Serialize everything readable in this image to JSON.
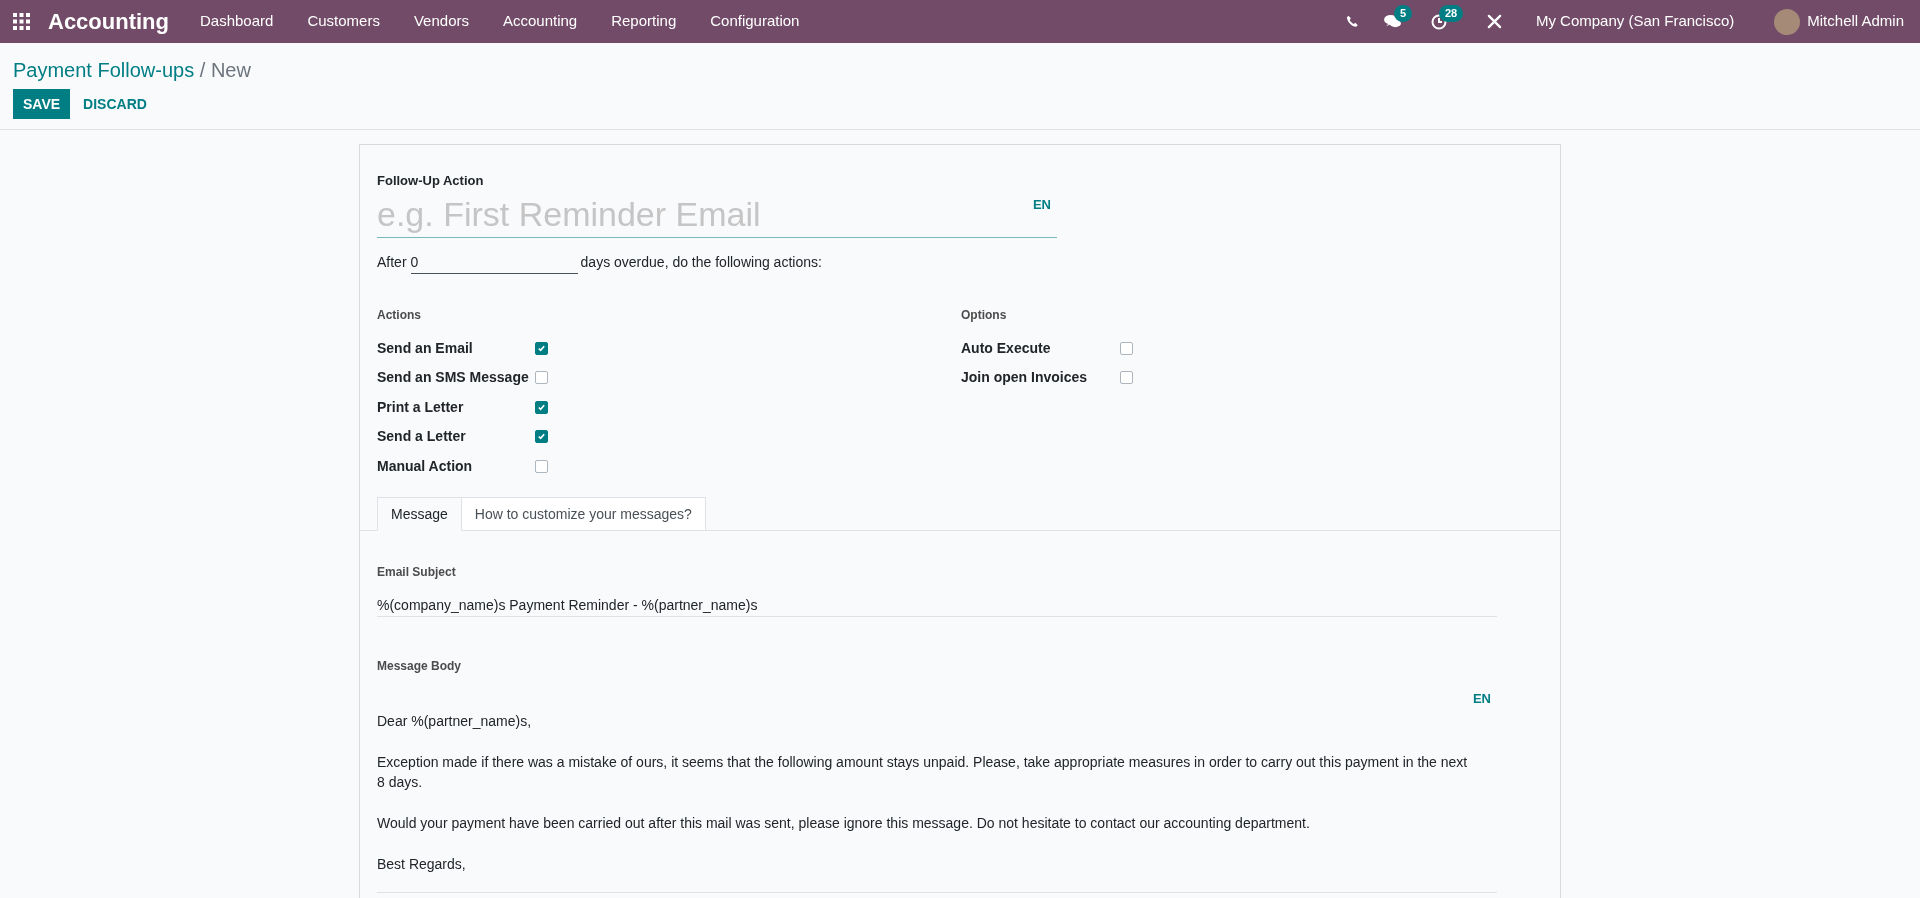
{
  "navbar": {
    "app_name": "Accounting",
    "menu": [
      "Dashboard",
      "Customers",
      "Vendors",
      "Accounting",
      "Reporting",
      "Configuration"
    ],
    "messages_badge": "5",
    "activities_badge": "28",
    "company": "My Company (San Francisco)",
    "user": "Mitchell Admin"
  },
  "breadcrumb": {
    "parent": "Payment Follow-ups",
    "separator": "/",
    "current": "New"
  },
  "buttons": {
    "save": "SAVE",
    "discard": "DISCARD"
  },
  "form": {
    "name_label": "Follow-Up Action",
    "name_placeholder": "e.g. First Reminder Email",
    "name_lang": "EN",
    "after_prefix": "After",
    "delay_value": "0",
    "after_suffix": "days overdue, do the following actions:",
    "actions_heading": "Actions",
    "actions": [
      {
        "label": "Send an Email",
        "checked": true
      },
      {
        "label": "Send an SMS Message",
        "checked": false
      },
      {
        "label": "Print a Letter",
        "checked": true
      },
      {
        "label": "Send a Letter",
        "checked": true
      },
      {
        "label": "Manual Action",
        "checked": false
      }
    ],
    "options_heading": "Options",
    "options": [
      {
        "label": "Auto Execute",
        "checked": false
      },
      {
        "label": "Join open Invoices",
        "checked": false
      }
    ],
    "tabs": [
      {
        "label": "Message",
        "selected": true
      },
      {
        "label": "How to customize your messages?",
        "selected": false
      }
    ],
    "email_subject_label": "Email Subject",
    "email_subject": "%(company_name)s Payment Reminder - %(partner_name)s",
    "message_body_label": "Message Body",
    "message_body_lang": "EN",
    "message_body": [
      "Dear %(partner_name)s,",
      "Exception made if there was a mistake of ours, it seems that the following amount stays unpaid. Please, take appropriate measures in order to carry out this payment in the next 8 days.",
      "Would your payment have been carried out after this mail was sent, please ignore this message. Do not hesitate to contact our accounting department.",
      "Best Regards,"
    ]
  }
}
